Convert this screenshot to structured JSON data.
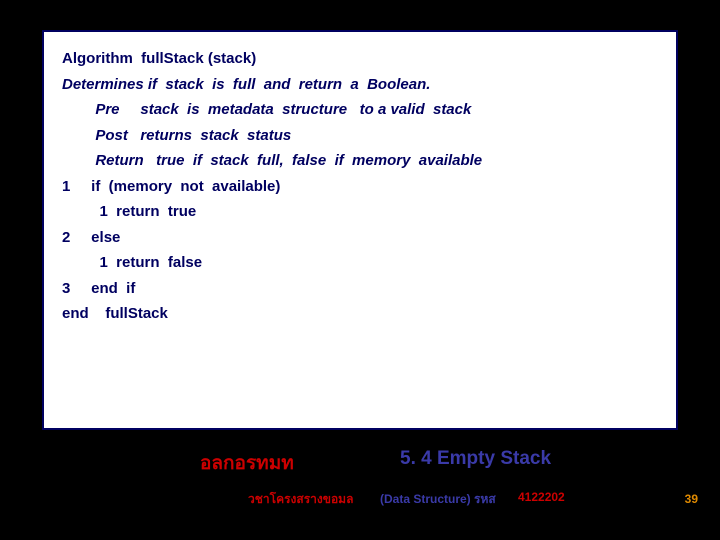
{
  "algo": {
    "title": "Algorithm  fullStack (stack)",
    "desc": "Determines if  stack  is  full  and  return  a  Boolean.",
    "pre": "        Pre     stack  is  metadata  structure   to a valid  stack",
    "post": "        Post   returns  stack  status",
    "return": "        Return   true  if  stack  full,  false  if  memory  available",
    "l1": "1     if  (memory  not  available)",
    "l1a": "         1  return  true",
    "l2": "2     else",
    "l2a": "         1  return  false",
    "l3": "3     end  if",
    "end": "end    fullStack"
  },
  "footer": {
    "red_title": "อลกอรทมท",
    "blue_title": "5. 4 Empty Stack",
    "sub_left": "วชาโครงสรางขอมล",
    "sub_mid": "(Data Structure) รหส",
    "sub_right": "4122202",
    "pagenum": "39"
  }
}
